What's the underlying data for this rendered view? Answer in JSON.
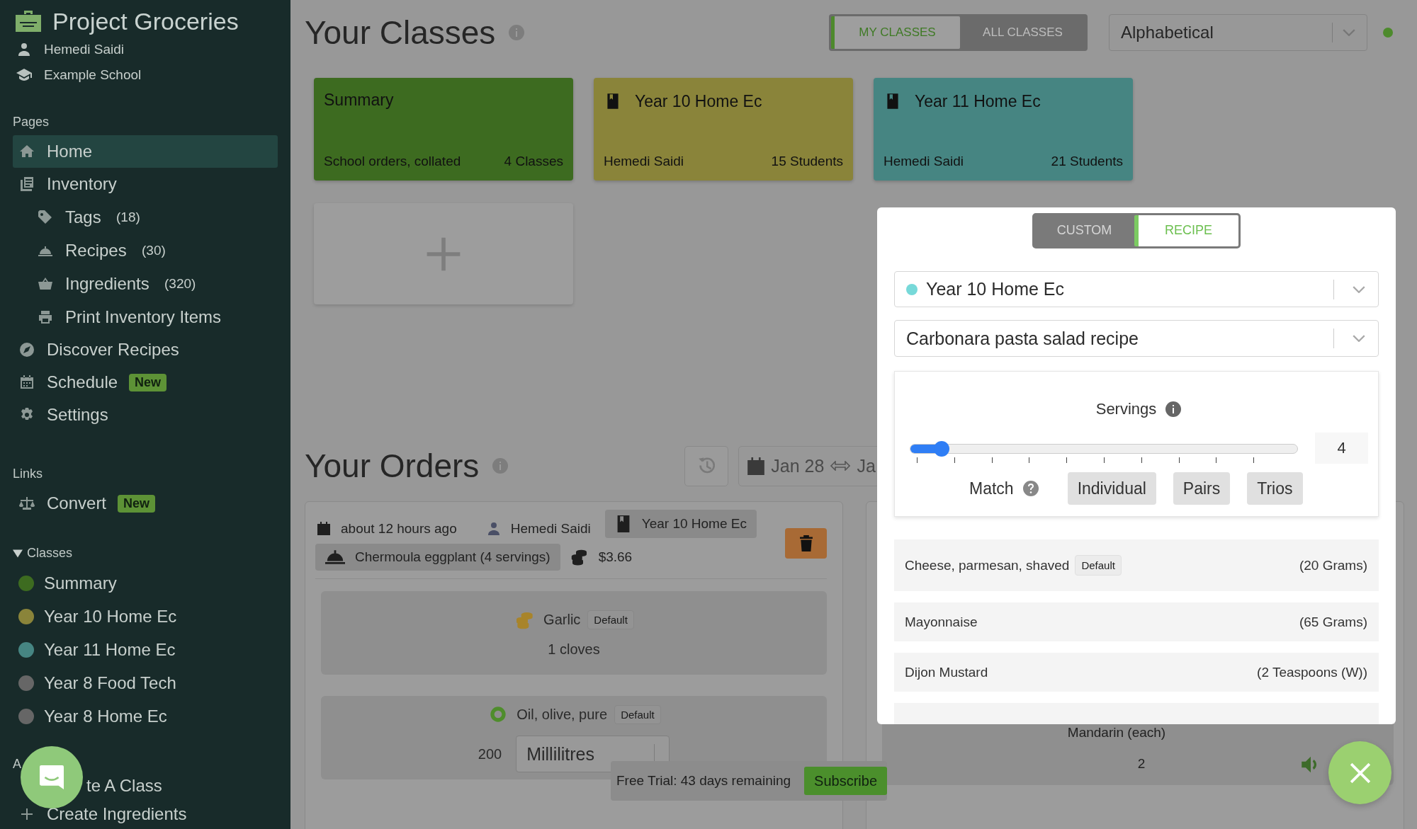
{
  "sidebar": {
    "app_title": "Project Groceries",
    "user": "Hemedi Saidi",
    "school": "Example School",
    "pages_heading": "Pages",
    "pages": [
      {
        "label": "Home",
        "selected": true
      },
      {
        "label": "Inventory",
        "selected": false,
        "children": [
          {
            "label": "Tags",
            "count": "(18)",
            "selected": false
          },
          {
            "label": "Recipes",
            "count": "(30)",
            "selected": false
          },
          {
            "label": "Ingredients",
            "count": "(320)",
            "selected": false
          },
          {
            "label": "Print Inventory Items",
            "selected": false
          }
        ]
      },
      {
        "label": "Discover Recipes",
        "selected": false
      },
      {
        "label": "Schedule",
        "badge": "New",
        "selected": false
      },
      {
        "label": "Settings",
        "selected": false
      }
    ],
    "links_heading": "Links",
    "links": [
      {
        "label": "Convert",
        "badge": "New",
        "selected": false
      }
    ],
    "classes_heading": {
      "label": "Classes",
      "expanded": true
    },
    "classes": [
      {
        "label": "Summary",
        "color": "#3d6b20",
        "selected": false
      },
      {
        "label": "Year 10 Home Ec",
        "color": "#8a843a",
        "selected": false
      },
      {
        "label": "Year 11 Home Ec",
        "color": "#468582",
        "selected": false
      },
      {
        "label": "Year 8 Food Tech",
        "color": "#666666",
        "selected": false
      },
      {
        "label": "Year 8 Home Ec",
        "color": "#666666",
        "selected": false
      }
    ],
    "actions_heading": "A",
    "actions": [
      {
        "label": "te A Class"
      },
      {
        "label": "Create Ingredients"
      }
    ]
  },
  "classes": {
    "title": "Your Classes",
    "view_tabs": [
      {
        "label": "MY CLASSES",
        "selected": true
      },
      {
        "label": "ALL CLASSES",
        "selected": false
      }
    ],
    "sort": "Alphabetical",
    "cards": [
      {
        "kind": "summary",
        "title": "Summary",
        "left": "School orders, collated",
        "right": "4 Classes",
        "color": "#3d6b20"
      },
      {
        "kind": "class",
        "title": "Year 10 Home Ec",
        "left": "Hemedi Saidi",
        "right": "15 Students",
        "color": "#8a843a"
      },
      {
        "kind": "class",
        "title": "Year 11 Home Ec",
        "left": "Hemedi Saidi",
        "right": "21 Students",
        "color": "#468582"
      }
    ]
  },
  "orders": {
    "title": "Your Orders",
    "date_start": "Jan 28",
    "date_end": "Ja",
    "order": {
      "time": "about 12 hours ago",
      "author": "Hemedi Saidi",
      "class": "Year 10 Home Ec",
      "recipe": "Chermoula eggplant (4 servings)",
      "cost": "$3.66",
      "items": [
        {
          "kind": "fixed",
          "name": "Garlic",
          "badge": "Default",
          "amount": "1 cloves"
        },
        {
          "kind": "editable",
          "name": "Oil, olive, pure",
          "badge": "Default",
          "quantity": "200",
          "unit": "Millilitres"
        }
      ]
    },
    "second_order": {
      "items": [
        {
          "name": "Mandarin (each)",
          "amount": "2"
        }
      ]
    }
  },
  "trial": {
    "text": "Free Trial: 43 days remaining",
    "button": "Subscribe"
  },
  "dialog": {
    "modes": [
      {
        "label": "CUSTOM",
        "selected": false
      },
      {
        "label": "RECIPE",
        "selected": true
      }
    ],
    "class_select": {
      "value": "Year 10 Home Ec",
      "color": "#77d9d9"
    },
    "recipe_select": {
      "value": "Carbonara pasta salad recipe"
    },
    "servings": {
      "label": "Servings",
      "level": 0.08,
      "value": "4"
    },
    "match": {
      "label": "Match",
      "options": [
        {
          "label": "Individual",
          "selected": false
        },
        {
          "label": "Pairs",
          "selected": false
        },
        {
          "label": "Trios",
          "selected": false
        }
      ]
    },
    "ingredients": [
      {
        "name": "Cheese, parmesan, shaved",
        "badge": "Default",
        "amount": "(20 Grams)"
      },
      {
        "name": "Mayonnaise",
        "amount": "(65 Grams)"
      },
      {
        "name": "Dijon Mustard",
        "amount": "(2 Teaspoons (W))"
      }
    ]
  }
}
